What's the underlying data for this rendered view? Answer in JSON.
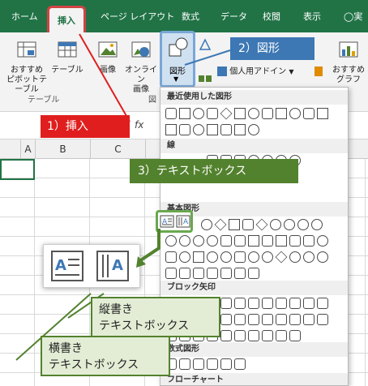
{
  "tabs": {
    "home": "ホーム",
    "insert": "挿入",
    "page_layout": "ページ レイアウト",
    "formulas": "数式",
    "data": "データ",
    "review": "校閲",
    "view": "表示",
    "tell_me": "実"
  },
  "ribbon": {
    "recommended_pivot_1": "おすすめ",
    "recommended_pivot_2": "ピボットテーブル",
    "table": "テーブル",
    "table_group": "テーブル",
    "picture": "画像",
    "online_pictures_1": "オンライン",
    "online_pictures_2": "画像",
    "shapes": "図形",
    "addins": "個人用アドイン",
    "recommended_charts_1": "おすすめ",
    "recommended_charts_2": "グラフ",
    "illustrations_group_partial": "図"
  },
  "formula_bar": {
    "fx": "fx"
  },
  "columns": [
    "A",
    "B",
    "C"
  ],
  "gallery": {
    "recent": "最近使用した図形",
    "lines": "線",
    "basic": "基本図形",
    "block_arrows": "ブロック矢印",
    "equation": "数式図形",
    "flowchart": "フローチャート"
  },
  "callouts": {
    "insert": "1）挿入",
    "shapes": "2）図形",
    "textbox": "3）テキストボックス",
    "vertical_1": "縦書き",
    "vertical_2": "テキストボックス",
    "horizontal_1": "横書き",
    "horizontal_2": "テキストボックス"
  },
  "colors": {
    "excel_green": "#217346",
    "highlight_red": "#e01e1e",
    "callout_blue": "#3d78b4",
    "callout_green": "#53822e"
  }
}
